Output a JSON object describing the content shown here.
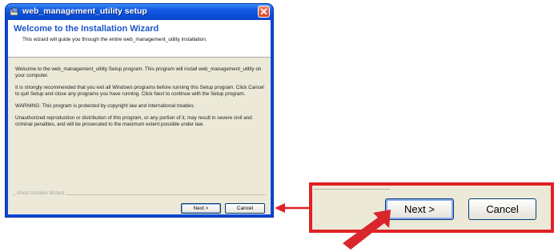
{
  "window": {
    "title": "web_management_utility setup"
  },
  "header": {
    "title": "Welcome to the Installation Wizard",
    "subtitle": "This wizard will guide you through the entire web_management_utility installation."
  },
  "body": {
    "paragraphs": [
      "Welcome to the web_management_utility Setup program. This program will install web_management_utility on your computer.",
      "It is strongly recommended that you exit all Windows programs before running this Setup program. Click Cancel to quit Setup and close any programs you have running. Click Next to continue with the Setup program.",
      "WARNING: This program is protected by copyright law and international treaties.",
      "Unauthorized reproduction or distribution of this program, or any portion of it, may result in severe civil and criminal penalties, and will be prosecuted to the maximum extent possible under law."
    ]
  },
  "footer": {
    "group_label": "Ghost Installer Wizard",
    "next_label": "Next >",
    "cancel_label": "Cancel"
  },
  "callout": {
    "next_label": "Next >",
    "cancel_label": "Cancel"
  },
  "colors": {
    "callout_red": "#e02126",
    "title_blue": "#1b55c8"
  },
  "icons": {
    "title": "installer-icon",
    "close": "close-icon",
    "arrow": "red-arrow-icon"
  }
}
